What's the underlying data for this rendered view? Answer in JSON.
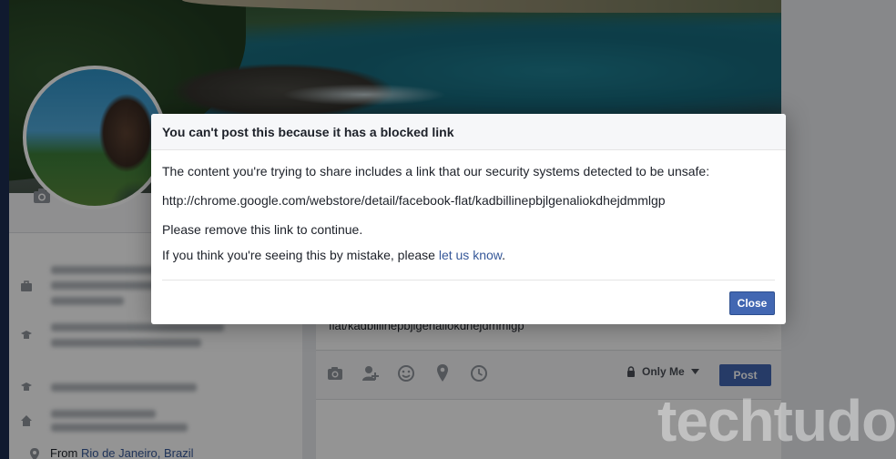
{
  "dialog": {
    "title": "You can't post this because it has a blocked link",
    "message_intro": "The content you're trying to share includes a link that our security systems detected to be unsafe:",
    "blocked_url": "http://chrome.google.com/webstore/detail/facebook-flat/kadbillinepbjlgenaliokdhejdmmlgp",
    "remove_prompt": "Please remove this link to continue.",
    "mistake_text": "If you think you're seeing this by mistake, please ",
    "mistake_link": "let us know",
    "mistake_end": ".",
    "close_label": "Close"
  },
  "composer": {
    "url_fragment": "flat/kadbillinepbjlgenaliokdhejdmmlgp",
    "tools": [
      "camera-icon",
      "tag-people-icon",
      "feeling-icon",
      "location-icon",
      "clock-icon"
    ],
    "audience_label": "Only Me",
    "post_label": "Post"
  },
  "profile": {
    "from_prefix": "From ",
    "from_location": "Rio de Janeiro, Brazil"
  },
  "watermark": "techtudo",
  "colors": {
    "brand_blue": "#4267b2",
    "link_blue": "#365899",
    "sidebar_navy": "#1d2e52"
  }
}
